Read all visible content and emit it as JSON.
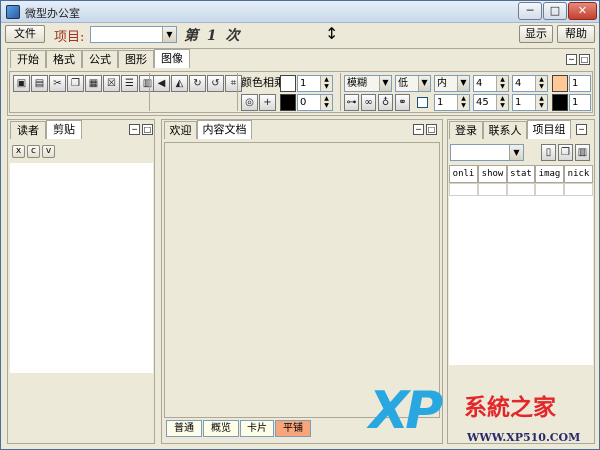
{
  "window": {
    "title": "微型办公室",
    "minimize": "─",
    "maximize": "□",
    "close": "✕"
  },
  "menubar": {
    "file": "文件",
    "project_label": "项目:",
    "project_value": "",
    "round": "第 1 次",
    "display": "显示",
    "help": "帮助"
  },
  "ribbon": {
    "tabs": [
      "开始",
      "格式",
      "公式",
      "图形",
      "图像"
    ],
    "active_tab": "图像",
    "color_label": "颜色相乘",
    "spin1": "1",
    "spin2": "0",
    "combo_blur": "模糊",
    "combo_low": "低",
    "combo_inner": "内",
    "val_a": "4",
    "val_b": "4",
    "val_c": "1",
    "val_d": "1",
    "val_e": "45",
    "val_f": "1",
    "val_g": "1",
    "swatch_color": "#ffc896",
    "black": "#000000"
  },
  "left_panel": {
    "tabs": [
      "读者",
      "剪贴"
    ],
    "active_tab": "剪贴",
    "buttons": [
      "x",
      "c",
      "v"
    ]
  },
  "center_panel": {
    "tabs": [
      "欢迎",
      "内容文档"
    ],
    "active_tab": "内容文档",
    "bottom_tabs": [
      "普通",
      "概览",
      "卡片",
      "平铺"
    ],
    "active_bottom": "平铺"
  },
  "right_panel": {
    "tabs": [
      "登录",
      "联系人",
      "项目组"
    ],
    "active_tab": "项目组",
    "columns": [
      "onli",
      "show",
      "stat",
      "imag",
      "nick"
    ]
  },
  "watermark": {
    "brand": "XP",
    "site_name": "系統之家",
    "url": "WWW.XP510.COM"
  }
}
